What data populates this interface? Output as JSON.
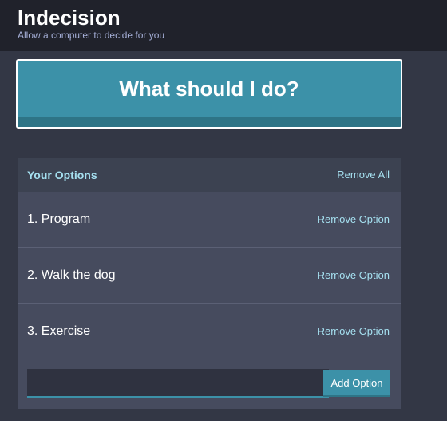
{
  "header": {
    "title": "Indecision",
    "subtitle": "Allow a computer to decide for you"
  },
  "action": {
    "label": "What should I do?"
  },
  "options_panel": {
    "title": "Your Options",
    "remove_all_label": "Remove All",
    "items": [
      {
        "text": "1. Program",
        "remove_label": "Remove Option"
      },
      {
        "text": "2. Walk the dog",
        "remove_label": "Remove Option"
      },
      {
        "text": "3. Exercise",
        "remove_label": "Remove Option"
      }
    ],
    "add_input": {
      "value": "",
      "placeholder": ""
    },
    "add_button_label": "Add Option"
  },
  "colors": {
    "header_bg": "#20222b",
    "page_bg": "#333745",
    "accent": "#3c91a8",
    "link": "#a5e0f0",
    "panel_bg": "#464b5e"
  }
}
